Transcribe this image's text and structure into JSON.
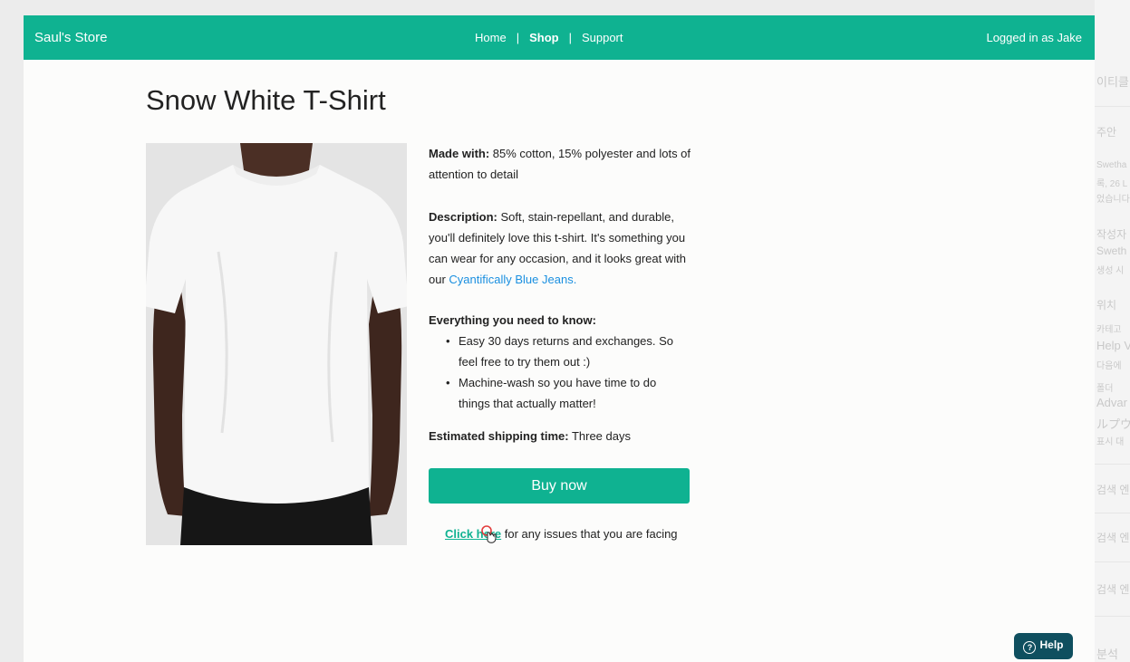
{
  "header": {
    "brand": "Saul's Store",
    "nav": {
      "home": "Home",
      "separator": "|",
      "shop": "Shop",
      "support": "Support"
    },
    "user": "Logged in as Jake"
  },
  "product": {
    "title": "Snow White T-Shirt",
    "made_label": "Made with:",
    "made_text": " 85% cotton, 15% polyester and lots of attention to detail",
    "desc_label": "Description:",
    "desc_text": " Soft, stain-repellant, and durable, you'll definitely love this t-shirt. It's something you can wear for any occasion, and it looks great with our ",
    "desc_link": "Cyantifically Blue Jeans.",
    "know_label": "Everything you need to know:",
    "bullets": [
      "Easy 30 days returns and exchanges. So feel free to try them out :)",
      "Machine-wash so you have time to do things that actually matter!"
    ],
    "ship_label": "Estimated shipping time:",
    "ship_text": " Three days",
    "buy_label": "Buy now",
    "issue_link": "Click here",
    "issue_text": " for any issues that you are facing"
  },
  "help_button": {
    "icon": "question-circle-icon",
    "label": "Help"
  },
  "background_page": {
    "lines": [
      "이티클",
      "주안",
      "Swetha",
      "록, 26 L",
      "었습니다",
      "작성자",
      "Sweth",
      "생성 시",
      "위치",
      "카테고",
      "Help V",
      "다음에",
      "폴더",
      "Advar",
      "ルプウ",
      "표시 대",
      "검색 엔",
      "검색 엔",
      "검색 엔",
      "분석"
    ]
  },
  "colors": {
    "accent": "#0fb291",
    "link": "#1a8fe0",
    "help_bg": "#0f4f5f"
  }
}
